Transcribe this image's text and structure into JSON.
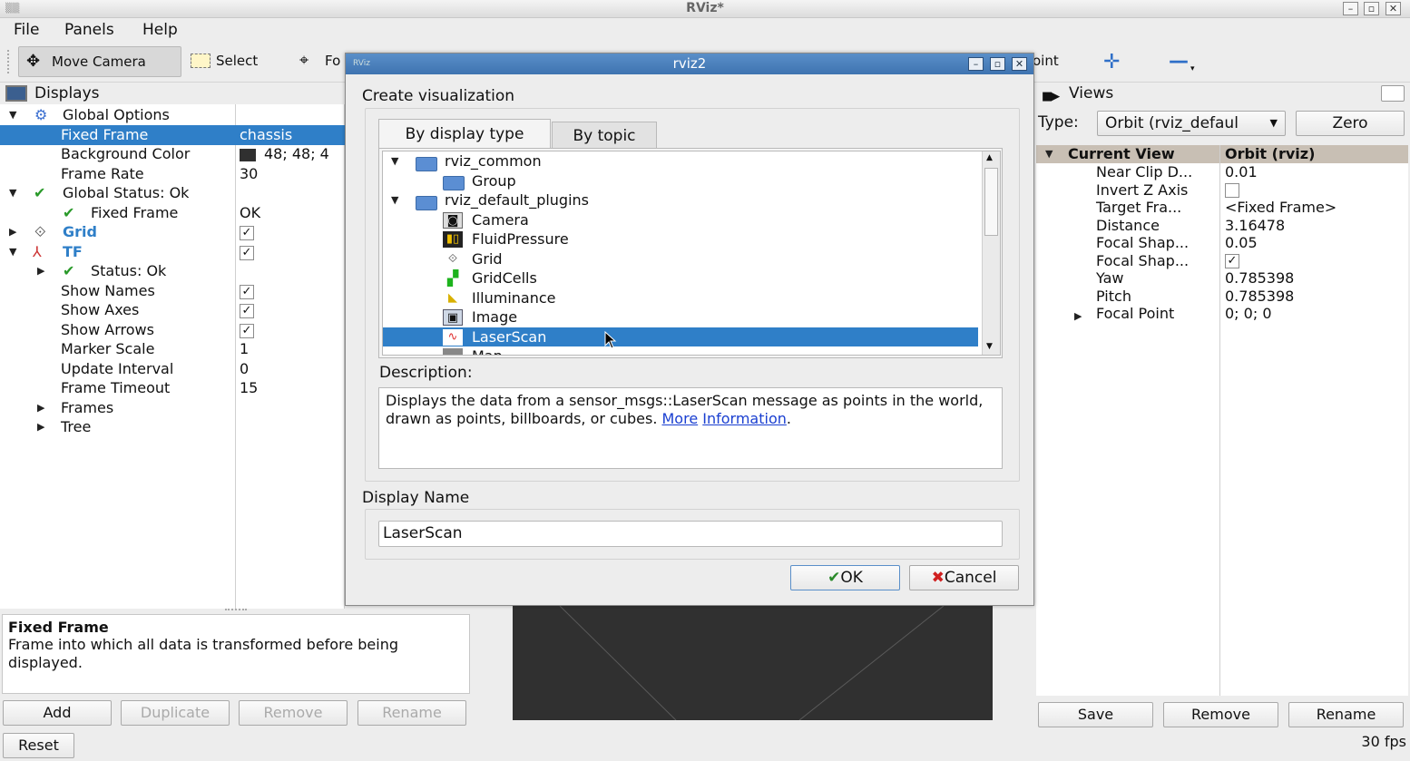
{
  "window": {
    "title": "RViz*"
  },
  "menu": [
    "File",
    "Panels",
    "Help"
  ],
  "toolbar": {
    "move_camera": "Move Camera",
    "select": "Select",
    "focus_partial": "Fo",
    "point_partial": "oint",
    "plus_icon": "plus-icon",
    "minus_icon": "minus-icon"
  },
  "displays": {
    "title": "Displays",
    "global_options": "Global Options",
    "fixed_frame": {
      "label": "Fixed Frame",
      "value": "chassis"
    },
    "background_color": {
      "label": "Background Color",
      "value": "48; 48; 4",
      "swatch": "#303030"
    },
    "frame_rate": {
      "label": "Frame Rate",
      "value": "30"
    },
    "global_status": "Global Status: Ok",
    "status_fixed_frame": {
      "label": "Fixed Frame",
      "value": "OK"
    },
    "grid": "Grid",
    "tf": "TF",
    "tf_status": "Status: Ok",
    "show_names": "Show Names",
    "show_axes": "Show Axes",
    "show_arrows": "Show Arrows",
    "marker_scale": {
      "label": "Marker Scale",
      "value": "1"
    },
    "update_interval": {
      "label": "Update Interval",
      "value": "0"
    },
    "frame_timeout": {
      "label": "Frame Timeout",
      "value": "15"
    },
    "frames": "Frames",
    "tree": "Tree",
    "help_title": "Fixed Frame",
    "help_text": "Frame into which all data is transformed before being displayed.",
    "buttons": {
      "add": "Add",
      "duplicate": "Duplicate",
      "remove": "Remove",
      "rename": "Rename"
    },
    "reset": "Reset"
  },
  "dialog": {
    "title": "rviz2",
    "heading": "Create visualization",
    "tabs": [
      "By display type",
      "By topic"
    ],
    "items": [
      {
        "label": "rviz_common",
        "kind": "folder"
      },
      {
        "label": "Group",
        "kind": "folder-child"
      },
      {
        "label": "rviz_default_plugins",
        "kind": "folder"
      },
      {
        "label": "Camera",
        "kind": "plugin",
        "icon": "camera-icon"
      },
      {
        "label": "FluidPressure",
        "kind": "plugin",
        "icon": "fluid-pressure-icon"
      },
      {
        "label": "Grid",
        "kind": "plugin",
        "icon": "grid-icon"
      },
      {
        "label": "GridCells",
        "kind": "plugin",
        "icon": "grid-cells-icon"
      },
      {
        "label": "Illuminance",
        "kind": "plugin",
        "icon": "illuminance-icon"
      },
      {
        "label": "Image",
        "kind": "plugin",
        "icon": "image-icon"
      },
      {
        "label": "LaserScan",
        "kind": "plugin",
        "icon": "laser-scan-icon"
      },
      {
        "label": "Map",
        "kind": "plugin",
        "icon": "map-icon"
      }
    ],
    "selected": "LaserScan",
    "description_label": "Description:",
    "description_text": "Displays the data from a sensor_msgs::LaserScan message as points in the world, drawn as points, billboards, or cubes.",
    "description_link1": "More",
    "description_link2": "Information",
    "description_end": ".",
    "display_name_label": "Display Name",
    "display_name_value": "LaserScan",
    "ok": "OK",
    "cancel": "Cancel"
  },
  "views": {
    "title": "Views",
    "type_label": "Type:",
    "type_value": "Orbit (rviz_defaul",
    "zero": "Zero",
    "header_key": "Current View",
    "header_value": "Orbit (rviz)",
    "rows": [
      {
        "label": "Near Clip D...",
        "value": "0.01"
      },
      {
        "label": "Invert Z Axis",
        "value": ""
      },
      {
        "label": "Target Fra...",
        "value": "<Fixed Frame>"
      },
      {
        "label": "Distance",
        "value": "3.16478"
      },
      {
        "label": "Focal Shap...",
        "value": "0.05"
      },
      {
        "label": "Focal Shap...",
        "value": "✓"
      },
      {
        "label": "Yaw",
        "value": "0.785398"
      },
      {
        "label": "Pitch",
        "value": "0.785398"
      },
      {
        "label": "Focal Point",
        "value": "0; 0; 0"
      }
    ],
    "buttons": {
      "save": "Save",
      "remove": "Remove",
      "rename": "Rename"
    }
  },
  "status": {
    "fps": "30 fps"
  },
  "colors": {
    "selection": "#2f7fc8",
    "viewport": "#303030"
  }
}
